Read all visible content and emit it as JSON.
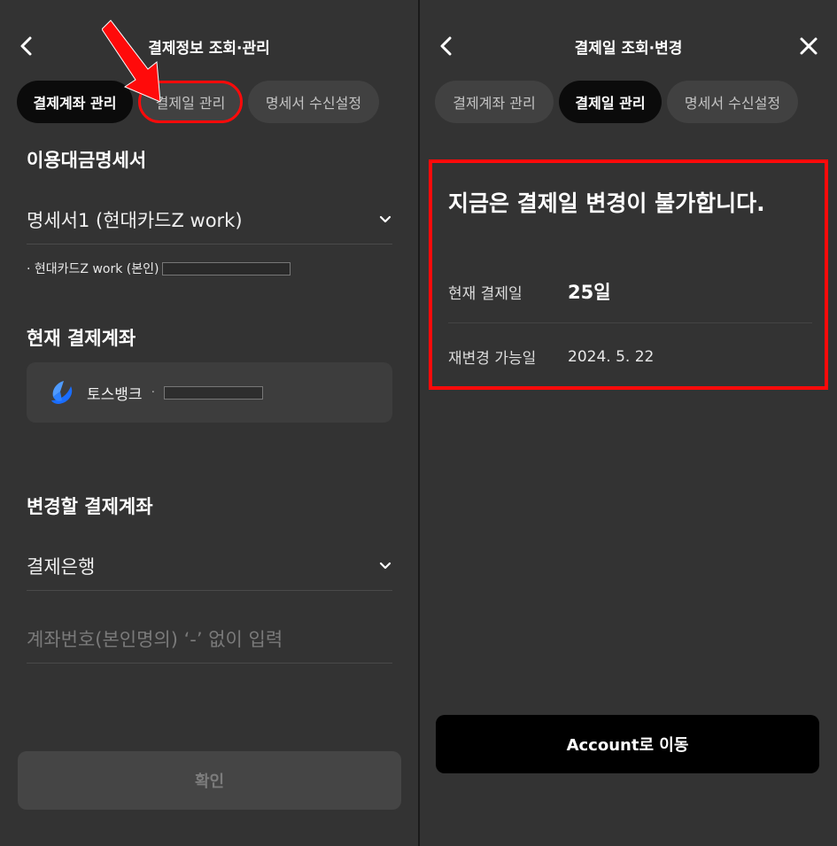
{
  "left": {
    "header_title": "결제정보 조회·관리",
    "tabs": [
      {
        "label": "결제계좌 관리",
        "state": "active"
      },
      {
        "label": "결제일 관리",
        "state": "highlighted"
      },
      {
        "label": "명세서 수신설정",
        "state": "inactive"
      }
    ],
    "statement_section_title": "이용대금명세서",
    "statement_select": "명세서1 (현대카드Z work)",
    "statement_owner": "· 현대카드Z work (본인)",
    "current_account_title": "현재 결제계좌",
    "bank_name": "토스뱅크",
    "change_account_title": "변경할 결제계좌",
    "bank_select": "결제은행",
    "account_placeholder": "계좌번호(본인명의) ‘-’ 없이 입력",
    "confirm_button": "확인"
  },
  "right": {
    "header_title": "결제일 조회·변경",
    "tabs": [
      {
        "label": "결제계좌 관리",
        "state": "inactive"
      },
      {
        "label": "결제일 관리",
        "state": "active"
      },
      {
        "label": "명세서 수신설정",
        "state": "inactive"
      }
    ],
    "notice": "지금은 결제일 변경이 불가합니다.",
    "rows": [
      {
        "label": "현재 결제일",
        "value": "25일"
      },
      {
        "label": "재변경 가능일",
        "value": "2024. 5. 22"
      }
    ],
    "account_button": "Account로 이동"
  },
  "colors": {
    "background": "#333333",
    "highlight_red": "#ff0a0a",
    "active_tab": "#0b0b0b",
    "inactive_tab": "#414141",
    "toss_blue": "#1a6dff"
  }
}
